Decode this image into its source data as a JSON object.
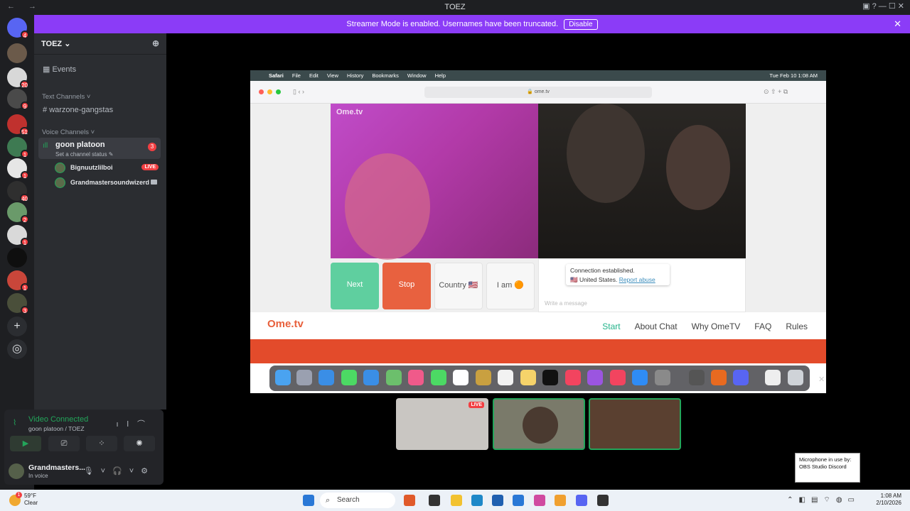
{
  "window": {
    "title": "TOEZ",
    "nav_arrows": "← →",
    "controls": "▣ ? — ☐ ✕"
  },
  "banner": {
    "text": "Streamer Mode is enabled. Usernames have been truncated.",
    "disable_label": "Disable",
    "close": "✕"
  },
  "servers": [
    {
      "badge": "4"
    },
    {
      "badge": ""
    },
    {
      "badge": "20"
    },
    {
      "badge": "9"
    },
    {
      "badge": "51"
    },
    {
      "badge": "1"
    },
    {
      "badge": "1"
    },
    {
      "badge": "40"
    },
    {
      "badge": "2"
    },
    {
      "badge": "1"
    },
    {
      "badge": ""
    },
    {
      "badge": "1"
    },
    {
      "badge": "3"
    }
  ],
  "sidebar": {
    "guild_name": "TOEZ ⌄",
    "events_label": "Events",
    "text_channels_label": "Text Channels ˅",
    "text_channel": "warzone-gangstas",
    "voice_channels_label": "Voice Channels ˅",
    "voice_channel": {
      "name": "goon platoon",
      "status_placeholder": "Set a channel status ✎",
      "count": "3"
    },
    "members": [
      {
        "name": "Bignuutzlilboi",
        "live": "LIVE"
      },
      {
        "name": "Grandmastersoundwizerd",
        "live": ""
      }
    ]
  },
  "voice_panel": {
    "status": "Video Connected",
    "location": "goon platoon / TOEZ"
  },
  "user": {
    "name": "Grandmasters...",
    "status": "In voice"
  },
  "mac": {
    "menu_items": [
      "Safari",
      "File",
      "Edit",
      "View",
      "History",
      "Bookmarks",
      "Window",
      "Help"
    ],
    "clock": "Tue Feb 10  1:08 AM",
    "url": "🔒 ome.tv"
  },
  "ometv": {
    "watermark": "Ome.tv",
    "buttons": {
      "next": "Next",
      "stop": "Stop",
      "country": "Country 🇺🇸",
      "iam": "I am 🟠"
    },
    "chat": {
      "line1": "Connection established.",
      "country": "🇺🇸 United States.",
      "report": "Report abuse",
      "placeholder": "Write a message"
    },
    "logo": "Ome.tv",
    "nav": [
      "Start",
      "About Chat",
      "Why OmeTV",
      "FAQ",
      "Rules"
    ]
  },
  "tiles": {
    "live_label": "LIVE"
  },
  "toast": {
    "text": "Microphone in use by: OBS Studio Discord"
  },
  "taskbar": {
    "temperature": "59°F",
    "condition": "Clear",
    "weather_badge": "1",
    "search_label": "Search",
    "time": "1:08 AM",
    "date": "2/10/2026"
  },
  "colors": {
    "accent": "#8b3cf7",
    "live": "#f23f42",
    "ome_next": "#5fcf9f",
    "ome_stop": "#e8613f",
    "voice_green": "#23a55a"
  }
}
